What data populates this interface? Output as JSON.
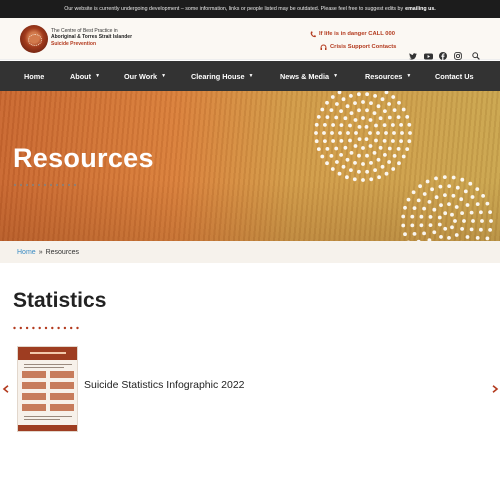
{
  "notice": {
    "text": "Our website is currently undergoing development – some information, links or people listed may be outdated. Please feel free to suggest edits by",
    "link": "emailing us."
  },
  "header": {
    "logo_lines": [
      "The Centre of Best Practice in",
      "Aboriginal & Torres Strait Islander",
      "Suicide Prevention"
    ],
    "danger_text": "If life is in danger CALL 000",
    "crisis_text": "Crisis Support Contacts",
    "social_icons": [
      "twitter-icon",
      "youtube-icon",
      "facebook-icon",
      "instagram-icon"
    ],
    "search_icon": "search-icon"
  },
  "nav": {
    "items": [
      {
        "label": "Home",
        "has_dropdown": false
      },
      {
        "label": "About",
        "has_dropdown": true
      },
      {
        "label": "Our Work",
        "has_dropdown": true
      },
      {
        "label": "Clearing House",
        "has_dropdown": true
      },
      {
        "label": "News & Media",
        "has_dropdown": true
      },
      {
        "label": "Resources",
        "has_dropdown": true
      },
      {
        "label": "Contact Us",
        "has_dropdown": false
      }
    ],
    "background": "#333333"
  },
  "hero": {
    "title": "Resources"
  },
  "breadcrumb": {
    "home": "Home",
    "separator": "»",
    "current": "Resources"
  },
  "section": {
    "title": "Statistics"
  },
  "carousel": {
    "items": [
      {
        "title": "Suicide Statistics Infographic 2022"
      }
    ],
    "prev_icon": "arrow-left-icon",
    "next_icon": "arrow-right-icon"
  },
  "colors": {
    "accent": "#b33a1e",
    "link": "#3a8bc3",
    "dark": "#1c1c1c"
  }
}
